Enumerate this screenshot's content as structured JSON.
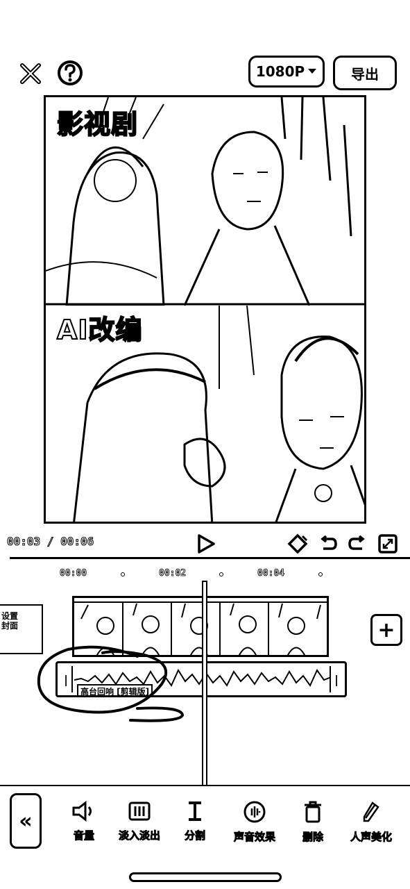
{
  "header": {
    "close_icon": "close-icon",
    "help_icon": "help-icon",
    "resolution_label": "1080P",
    "export_label": "导出"
  },
  "preview": {
    "top_label": "影视剧",
    "bottom_label": "AI改编"
  },
  "controls": {
    "time_display": "00:03 / 00:06",
    "icons": [
      "play-icon",
      "keyframe-icon",
      "undo-icon",
      "redo-icon",
      "fullscreen-icon"
    ]
  },
  "timeline": {
    "ruler": [
      "00:00",
      "00:02",
      "00:04"
    ],
    "cover_label_lines": [
      "设置",
      "封面"
    ],
    "audio_label": "高台回响 [剪辑版]",
    "add_label": "+"
  },
  "toolbar": {
    "back_label": "«",
    "tools": [
      {
        "label": "音量",
        "icon": "volume-icon"
      },
      {
        "label": "淡入淡出",
        "icon": "fade-icon"
      },
      {
        "label": "分割",
        "icon": "split-icon"
      },
      {
        "label": "声音效果",
        "icon": "sound-effect-icon"
      },
      {
        "label": "删除",
        "icon": "delete-icon"
      },
      {
        "label": "人声美化",
        "icon": "voice-beautify-icon"
      }
    ]
  }
}
